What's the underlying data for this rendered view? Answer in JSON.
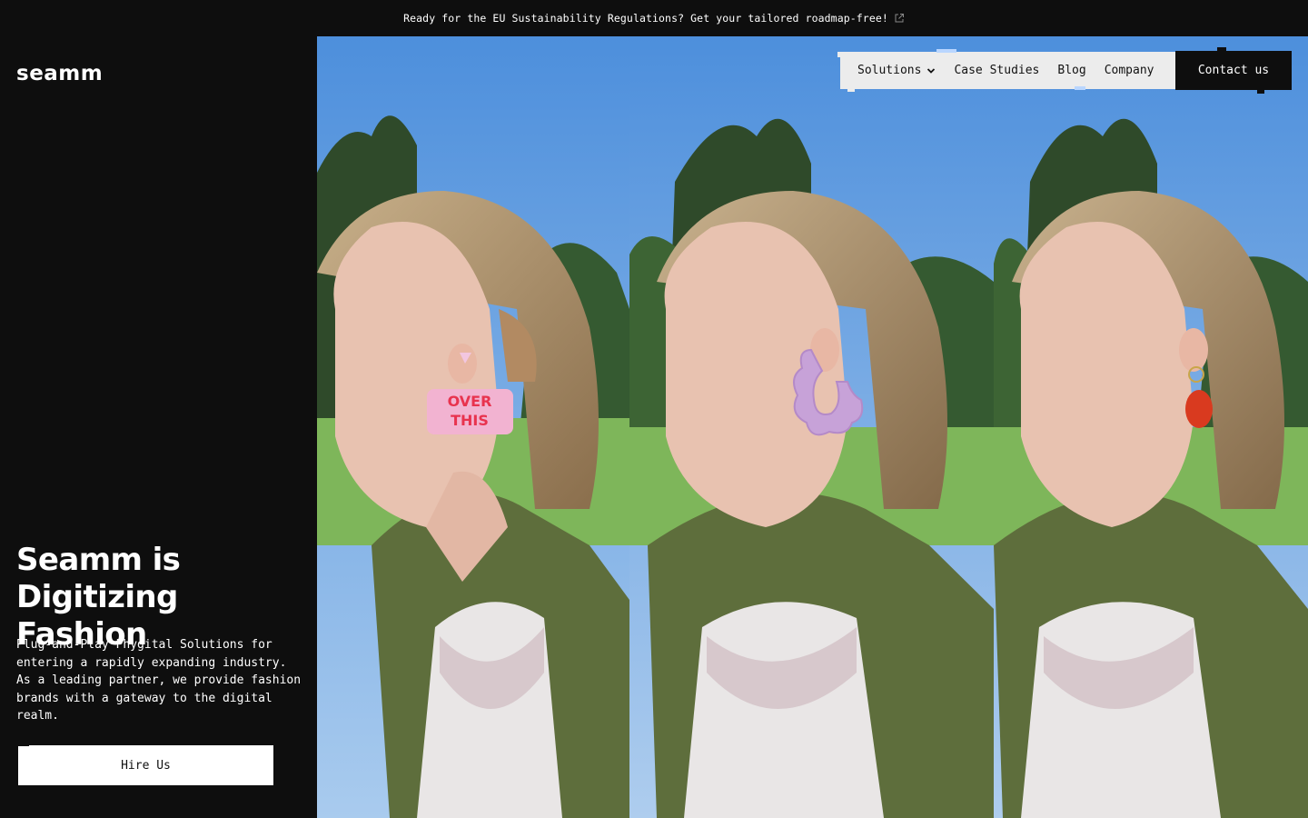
{
  "announcement": {
    "text": "Ready for the EU Sustainability Regulations? Get your tailored roadmap-free!",
    "icon": "external-link-icon"
  },
  "brand": {
    "logo_text": "seamm"
  },
  "hero": {
    "headline_line1": "Seamm is",
    "headline_line2": "Digitizing Fashion",
    "subtitle": "Plug-and-Play Phygital Solutions for entering a rapidly expanding industry. As a leading partner, we provide fashion brands with a gateway to the digital realm.",
    "cta_label": "Hire Us",
    "image_panels": [
      {
        "earring": "pink-over-this-earring",
        "earring_text": "OVER THIS"
      },
      {
        "earring": "lilac-flower-hoop-earring"
      },
      {
        "earring": "red-drop-earring"
      }
    ]
  },
  "nav": {
    "items": [
      {
        "label": "Solutions",
        "icon": "chevron-down-icon"
      },
      {
        "label": "Case Studies"
      },
      {
        "label": "Blog"
      },
      {
        "label": "Company"
      }
    ],
    "contact_label": "Contact us"
  },
  "colors": {
    "background": "#0e0e0e",
    "text": "#ffffff",
    "nav_bg": "#ececec",
    "button_bg": "#ffffff"
  }
}
